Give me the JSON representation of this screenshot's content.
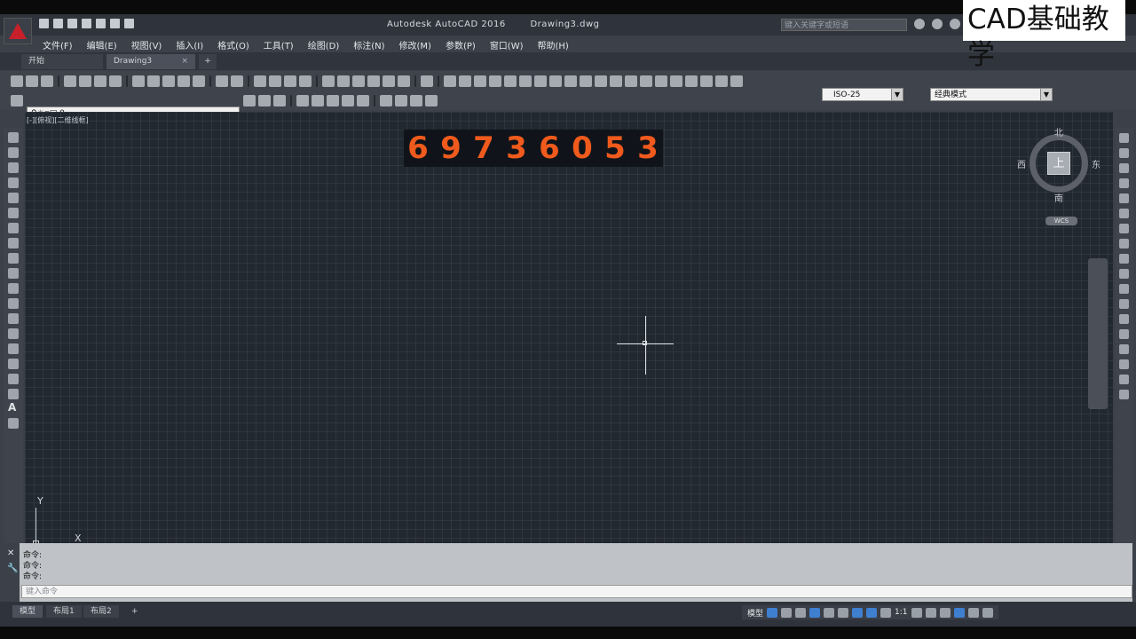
{
  "title": {
    "app": "Autodesk AutoCAD 2016",
    "file": "Drawing3.dwg",
    "search_placeholder": "键入关键字或短语"
  },
  "menu": [
    "文件(F)",
    "编辑(E)",
    "视图(V)",
    "插入(I)",
    "格式(O)",
    "工具(T)",
    "绘图(D)",
    "标注(N)",
    "修改(M)",
    "参数(P)",
    "窗口(W)",
    "帮助(H)"
  ],
  "tabs": {
    "start": "开始",
    "drawing": "Drawing3",
    "close": "×",
    "new": "+"
  },
  "toolbar": {
    "layer": "0",
    "dimstyle": "ISO-25",
    "workspace": "经典模式"
  },
  "viewport": {
    "label": "[-][俯视][二维线框]",
    "counter": "69736053"
  },
  "viewcube": {
    "north": "北",
    "south": "南",
    "west": "西",
    "east": "东",
    "top": "上",
    "wcs": "WCS"
  },
  "ucs": {
    "x": "X",
    "y": "Y"
  },
  "command": {
    "history": [
      "命令:",
      "命令:",
      "命令:"
    ],
    "placeholder": "键入命令"
  },
  "layout_tabs": [
    "模型",
    "布局1",
    "布局2",
    "+"
  ],
  "status": {
    "model": "模型",
    "scale": "1:1"
  },
  "watermark": "CAD基础教学",
  "colors": {
    "canvas": "#212830",
    "counter_digits": "#f05a1c",
    "logo": "#c8202b"
  }
}
